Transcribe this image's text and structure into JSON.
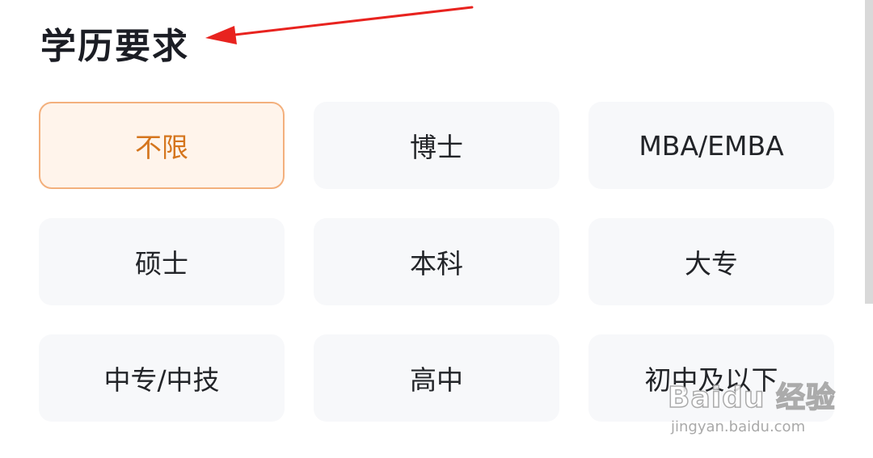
{
  "section": {
    "title": "学历要求"
  },
  "options": [
    {
      "label": "不限",
      "selected": true
    },
    {
      "label": "博士",
      "selected": false
    },
    {
      "label": "MBA/EMBA",
      "selected": false
    },
    {
      "label": "硕士",
      "selected": false
    },
    {
      "label": "本科",
      "selected": false
    },
    {
      "label": "大专",
      "selected": false
    },
    {
      "label": "中专/中技",
      "selected": false
    },
    {
      "label": "高中",
      "selected": false
    },
    {
      "label": "初中及以下",
      "selected": false
    }
  ],
  "colors": {
    "selected_border": "#f3b07d",
    "selected_text": "#d5751d",
    "selected_bg": "#fff4eb",
    "option_bg": "#f7f8fa",
    "annotation_arrow": "#e8231f"
  },
  "watermark": {
    "main": "Baidu 经验",
    "sub": "jingyan.baidu.com"
  }
}
